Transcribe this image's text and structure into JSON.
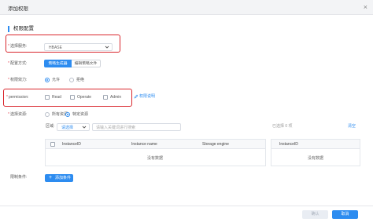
{
  "dialog": {
    "title": "添加权限",
    "close_glyph": "×"
  },
  "section": {
    "title": "权限配置"
  },
  "service": {
    "label": "选择服务:",
    "value": "HBASE"
  },
  "config_mode": {
    "label": "配置方式:",
    "options": [
      "策略生成器",
      "编辑策略文件"
    ],
    "selected": 0
  },
  "effect": {
    "label": "权限效力:",
    "options": [
      "允许",
      "拒绝"
    ],
    "selected": 0
  },
  "permission": {
    "label": "permission:",
    "options": [
      "Read",
      "Operate",
      "Admin"
    ],
    "help": "权限说明"
  },
  "resource": {
    "label": "选择资源:",
    "options": [
      "所有资源",
      "特定资源"
    ],
    "selected": 1
  },
  "region": {
    "label": "区域:",
    "select_placeholder": "请选择",
    "search_placeholder": "请输入关键词进行搜索"
  },
  "selected_info": {
    "text": "已选择 0 项",
    "count": "0",
    "clear": "清空"
  },
  "table_left": {
    "columns": [
      "InstanceID",
      "Instance name",
      "Storage engine"
    ],
    "empty": "没有数据"
  },
  "table_right": {
    "columns": [
      "InstanceID"
    ],
    "empty": "没有数据"
  },
  "restriction": {
    "label": "限制条件:",
    "add_label": "添加条件",
    "add_glyph": "+"
  },
  "footer": {
    "confirm": "确认",
    "cancel": "取消"
  },
  "colors": {
    "accent": "#2d8cf0",
    "highlight_box": "#d9262c"
  },
  "icons": {
    "close": "close-icon",
    "dropdown": "chevron-down-icon",
    "help": "pencil-icon",
    "search": "search-icon"
  }
}
